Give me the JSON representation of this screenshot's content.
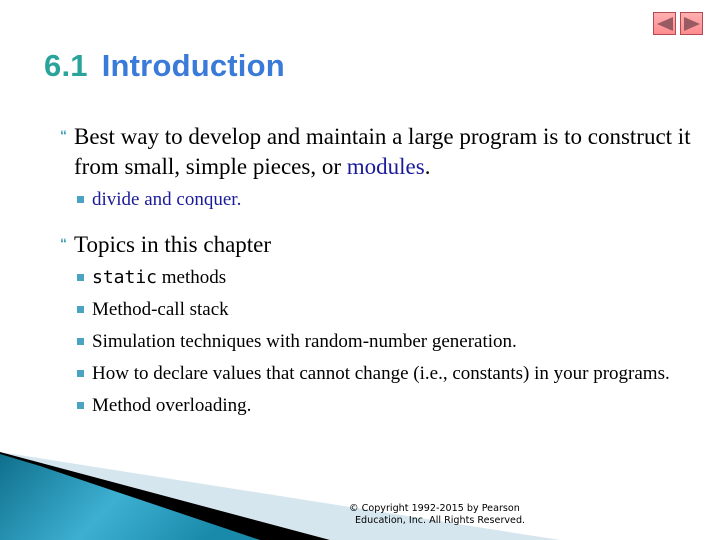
{
  "navigation": {
    "previous_icon": "triangle-left-icon",
    "next_icon": "triangle-right-icon",
    "button_color": "#ff9aa0",
    "arrow_color": "#9a5a62"
  },
  "slide": {
    "section_number": "6.1",
    "title": "Introduction",
    "title_number_color": "#2aa39a",
    "title_color": "#3a7ad8"
  },
  "bullets": [
    {
      "text_before": "Best way to develop and maintain a large program is to construct it from small, simple pieces, or ",
      "highlight": "modules",
      "text_after": ".",
      "sub": [
        {
          "text": "divide and conquer."
        }
      ]
    },
    {
      "text": "Topics in this chapter",
      "sub": [
        {
          "code": "static",
          "text": " methods"
        },
        {
          "text": "Method-call stack"
        },
        {
          "text": "Simulation techniques with random-number generation."
        },
        {
          "text": "How to declare values that cannot change (i.e., constants) in your programs."
        },
        {
          "text": "Method overloading."
        }
      ]
    }
  ],
  "footer": {
    "copyright_line1": "© Copyright 1992-2015 by Pearson",
    "copyright_line2": "Education, Inc. All Rights Reserved."
  },
  "colors": {
    "bullet_level1": "#3aa0b8",
    "bullet_level2": "#4ba3c2",
    "highlight_text": "#1a1a9a",
    "swoosh_teal": "#1d8aa8",
    "swoosh_black": "#000000",
    "swoosh_light": "#d6e6ee"
  }
}
